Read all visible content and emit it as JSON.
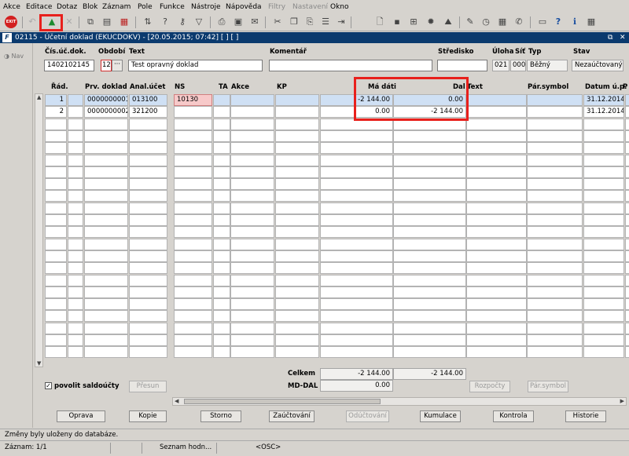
{
  "menu": [
    "Akce",
    "Editace",
    "Dotaz",
    "Blok",
    "Záznam",
    "Pole",
    "Funkce",
    "Nástroje",
    "Nápověda",
    "Filtry",
    "Nastavení",
    "Okno"
  ],
  "menu_disabled": [
    "Filtry",
    "Nastavení"
  ],
  "window": {
    "title": "02115 - Účetní doklad (EKUCDOKV) - [20.05.2015; 07:42] [ ] [ ]",
    "nav_label": "Nav"
  },
  "header": {
    "cis_label": "Čís.úč.dok.",
    "cis_value": "1402102145",
    "obdobi_label": "Období",
    "obdobi_value": "12",
    "text_label": "Text",
    "text_value": "Test opravný doklad",
    "komentar_label": "Komentář",
    "komentar_value": "",
    "stredisko_label": "Středisko",
    "stredisko_value": "",
    "uloha_label": "Úloha",
    "uloha_value": "021",
    "sit_label": "Síť",
    "sit_value": "000",
    "typ_label": "Typ",
    "typ_value": "Běžný",
    "stav_label": "Stav",
    "stav_value": "Nezaúčtovaný"
  },
  "grid": {
    "columns": [
      "Řád.",
      "Prv. doklad",
      "Anal.účet",
      "NS",
      "TA",
      "Akce",
      "KP",
      "Má dáti",
      "Dal",
      "Text",
      "Pár.symbol",
      "Datum ú.p.",
      "P"
    ],
    "rows": [
      {
        "rad": "1",
        "prv": "0000000001",
        "anal": "013100",
        "ns": "10130",
        "ma_dati": "-2 144.00",
        "dal": "0.00",
        "text": "",
        "par": "",
        "datum": "31.12.2014"
      },
      {
        "rad": "2",
        "prv": "0000000002",
        "anal": "321200",
        "ns": "",
        "ma_dati": "0.00",
        "dal": "-2 144.00",
        "text": "",
        "par": "",
        "datum": "31.12.2014"
      }
    ]
  },
  "totals": {
    "celkem_label": "Celkem",
    "celkem_md": "-2 144.00",
    "celkem_dal": "-2 144.00",
    "mddal_label": "MD-DAL",
    "mddal_value": "0.00"
  },
  "povolit": {
    "label": "povolit saldoúčty",
    "checked": true
  },
  "buttons": {
    "presun": "Přesun",
    "rozpocty": "Rozpočty",
    "par_symbol": "Pár.symbol",
    "oprava": "Oprava",
    "kopie": "Kopie",
    "storno": "Storno",
    "zauctovani": "Zaúčtování",
    "oductovani": "Odúčtování",
    "kumulace": "Kumulace",
    "kontrola": "Kontrola",
    "historie": "Historie"
  },
  "status": {
    "message": "Změny byly uloženy do databáze.",
    "zaznam": "Záznam: 1/1",
    "seznam": "Seznam hodn...",
    "osc": "<OSC>"
  },
  "colors": {
    "title_bar": "#0b3a6e",
    "highlight": "#e8201c",
    "selected_row": "#cfe0f4",
    "ns_cell": "#f7c9c9"
  }
}
